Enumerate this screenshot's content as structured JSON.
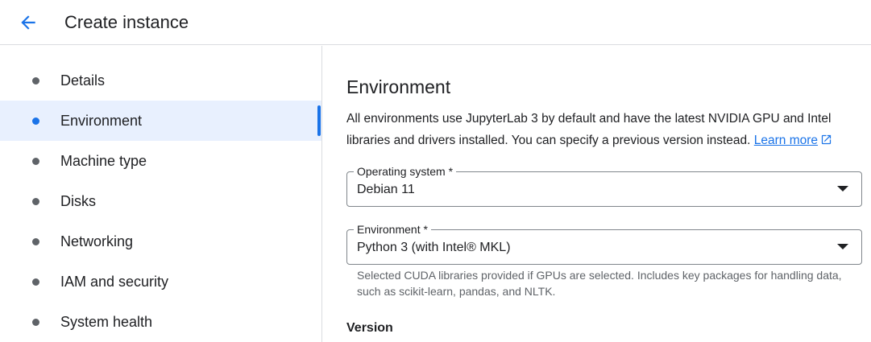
{
  "header": {
    "back_icon": "arrow-back-icon",
    "title": "Create instance"
  },
  "sidebar": {
    "active_color": "#1a73e8",
    "items": [
      {
        "label": "Details"
      },
      {
        "label": "Environment",
        "active": true
      },
      {
        "label": "Machine type"
      },
      {
        "label": "Disks"
      },
      {
        "label": "Networking"
      },
      {
        "label": "IAM and security"
      },
      {
        "label": "System health"
      }
    ]
  },
  "main": {
    "title": "Environment",
    "description": "All environments use JupyterLab 3 by default and have the latest NVIDIA GPU and Intel libraries and drivers installed. You can specify a previous version instead.",
    "learn_more": "Learn more",
    "learn_more_icon": "open-in-new-icon",
    "os_field": {
      "label": "Operating system *",
      "value": "Debian 11"
    },
    "env_field": {
      "label": "Environment *",
      "value": "Python 3 (with Intel® MKL)"
    },
    "env_hint": "Selected CUDA libraries provided if GPUs are selected. Includes key packages for handling data, such as scikit-learn, pandas, and NLTK.",
    "version_heading": "Version"
  }
}
